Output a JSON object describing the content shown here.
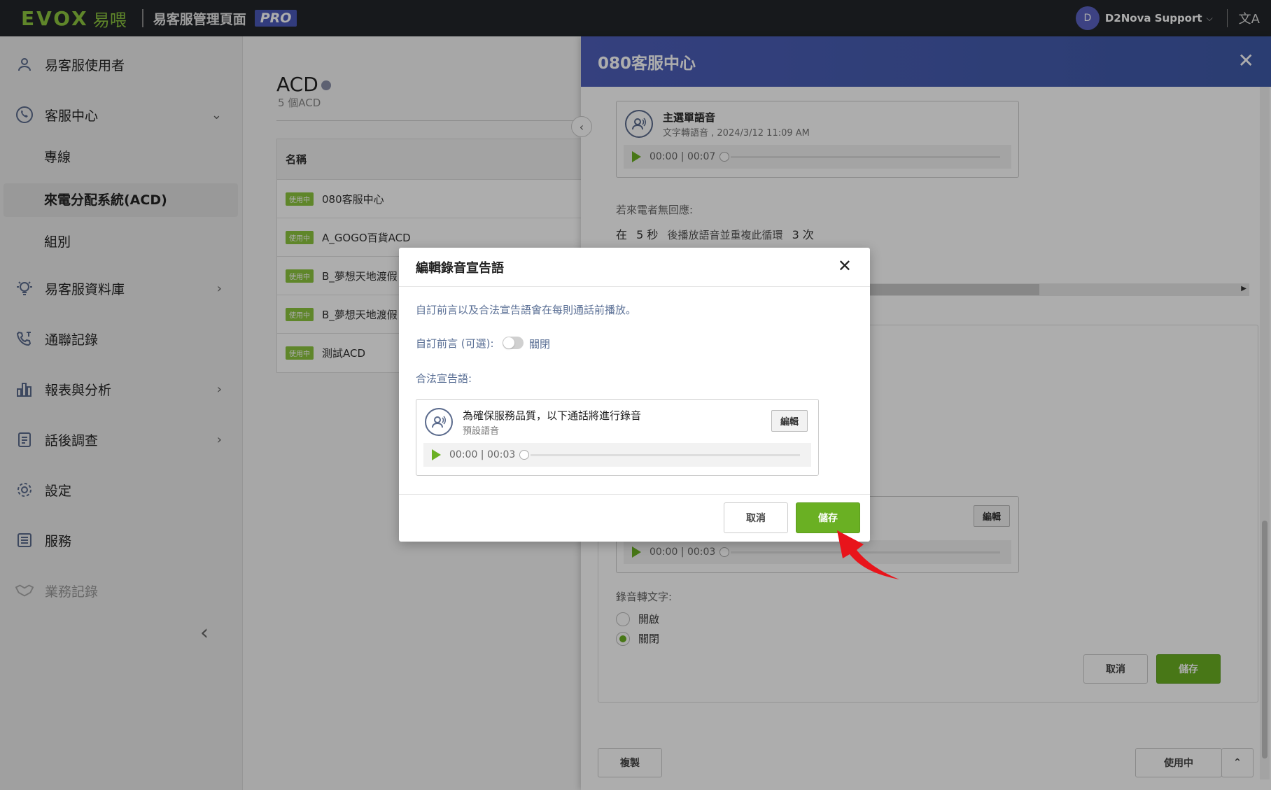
{
  "topbar": {
    "logo": "EVOX",
    "logo_cn": "易喂",
    "title": "易客服管理頁面",
    "pro": "PRO",
    "avatar_letter": "D",
    "user": "D2Nova Support",
    "icons": {
      "user_menu": "chevron-down-icon",
      "language": "translate-icon"
    }
  },
  "sidebar": {
    "items": [
      {
        "label": "易客服使用者",
        "icon": "user-icon"
      },
      {
        "label": "客服中心",
        "icon": "headset-icon",
        "chevron": "chevron-down-icon"
      },
      {
        "label": "易客服資料庫",
        "icon": "bulb-icon",
        "chevron": "chevron-right-icon"
      },
      {
        "label": "通聯記錄",
        "icon": "phone-log-icon"
      },
      {
        "label": "報表與分析",
        "icon": "bar-chart-icon",
        "chevron": "chevron-right-icon"
      },
      {
        "label": "話後調查",
        "icon": "clipboard-icon",
        "chevron": "chevron-right-icon"
      },
      {
        "label": "設定",
        "icon": "gear-icon"
      },
      {
        "label": "服務",
        "icon": "list-icon"
      },
      {
        "label": "業務記錄",
        "icon": "handshake-icon"
      }
    ],
    "subitems": [
      "專線",
      "來電分配系統(ACD)",
      "組別"
    ],
    "active_subitem": "來電分配系統(ACD)",
    "collapse_icon": "chevron-left-icon"
  },
  "main": {
    "title": "ACD",
    "subtitle": "5 個ACD",
    "table_header": "名稱",
    "rows": [
      {
        "tag": "使用中",
        "name": "080客服中心"
      },
      {
        "tag": "使用中",
        "name": "A_GOGO百貨ACD"
      },
      {
        "tag": "使用中",
        "name": "B_夢想天地渡假"
      },
      {
        "tag": "使用中",
        "name": "B_夢想天地渡假"
      },
      {
        "tag": "使用中",
        "name": "測試ACD"
      }
    ]
  },
  "drawer": {
    "title": "080客服中心",
    "menu_voice": {
      "name": "主選單語音",
      "meta": "文字轉語音 , 2024/3/12 11:09 AM",
      "time": "00:00 | 00:07"
    },
    "no_response_label": "若來電者無回應:",
    "no_response_prefix": "在",
    "no_response_seconds": "5 秒",
    "no_response_mid": "後播放語音並重複此循環",
    "no_response_times": "3 次",
    "second_voice": {
      "time": "00:00 | 00:03",
      "edit": "編輯"
    },
    "stt_label": "錄音轉文字:",
    "stt_options": [
      {
        "label": "開啟",
        "selected": false
      },
      {
        "label": "關閉",
        "selected": true
      }
    ],
    "cancel": "取消",
    "save": "儲存",
    "copy": "複製",
    "status": "使用中"
  },
  "modal": {
    "title": "編輯錄音宣告語",
    "description": "自訂前言以及合法宣告語會在每則通話前播放。",
    "custom_intro_label": "自訂前言 (可選):",
    "toggle_state": "關閉",
    "legal_label": "合法宣告語:",
    "voice": {
      "name": "為確保服務品質，以下通話將進行錄音",
      "meta": "預設語音",
      "time": "00:00 | 00:03",
      "edit": "編輯"
    },
    "cancel": "取消",
    "save": "儲存"
  },
  "colors": {
    "accent_green": "#6ab023",
    "brand_green": "#8cc63f",
    "header_blue": "#4e5fba",
    "pro_badge": "#4a59b8",
    "arrow_red": "#e8141b"
  }
}
